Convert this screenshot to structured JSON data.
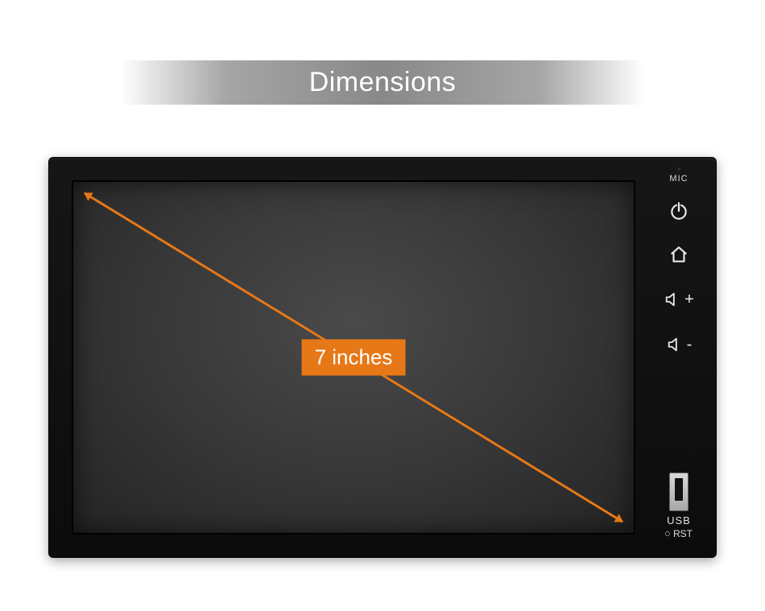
{
  "title": "Dimensions",
  "screen_size_label": "7 inches",
  "side": {
    "mic": "MIC",
    "usb": "USB",
    "rst": "RST",
    "vol_up": "+",
    "vol_down": "-"
  },
  "colors": {
    "accent": "#e77817"
  }
}
